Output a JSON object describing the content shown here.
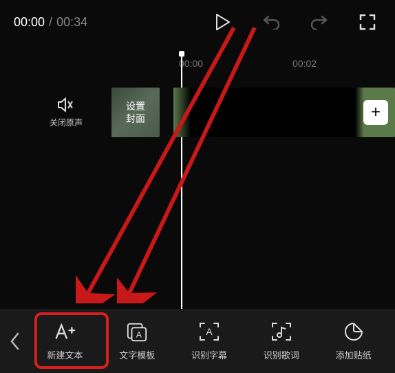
{
  "time": {
    "current": "00:00",
    "separator": "/",
    "total": "00:34"
  },
  "timeline": {
    "marks": [
      "00:00",
      "00:02"
    ],
    "mute_label": "关闭原声",
    "cover_label": "设置\n封面",
    "add_label": "+"
  },
  "tools": {
    "new_text": "新建文本",
    "text_template": "文字模板",
    "recognize_subtitle": "识别字幕",
    "recognize_lyrics": "识别歌词",
    "add_sticker": "添加贴纸"
  }
}
